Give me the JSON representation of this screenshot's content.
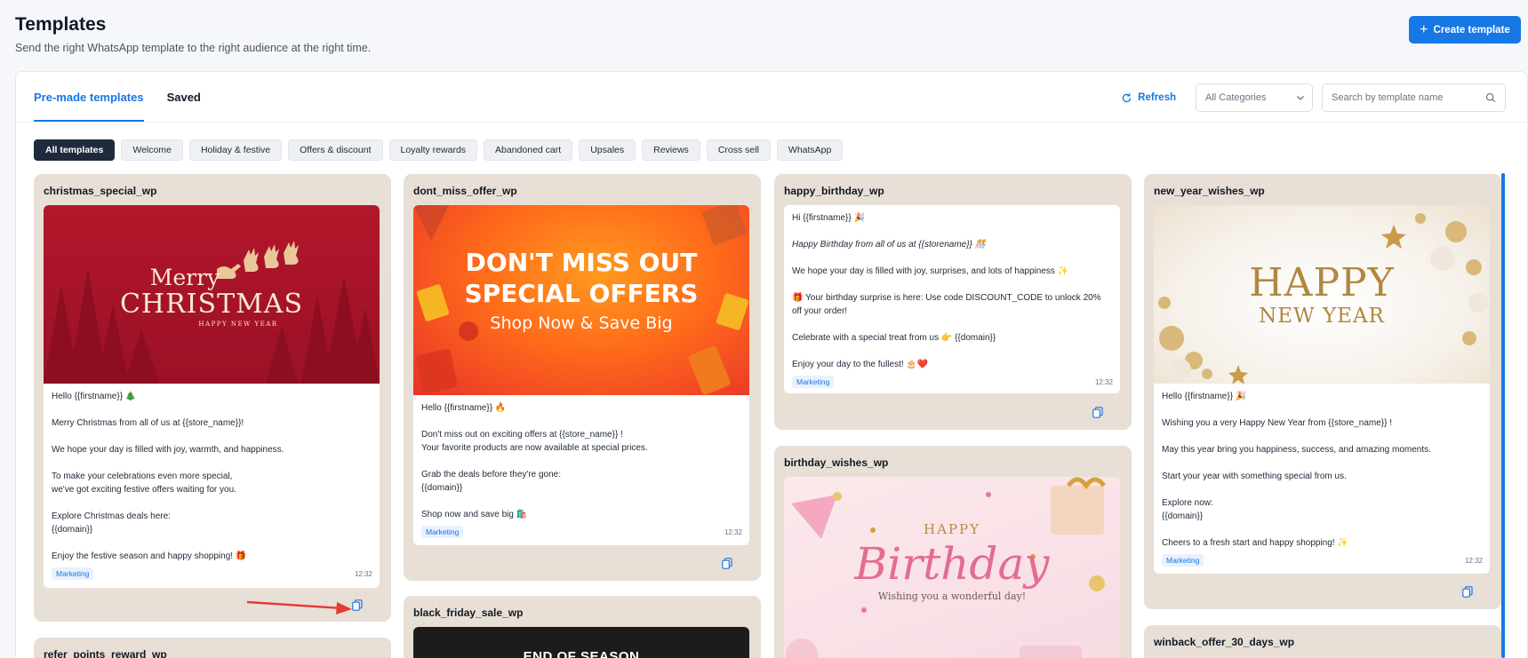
{
  "header": {
    "title": "Templates",
    "subtitle": "Send the right WhatsApp template to the right audience at the right time.",
    "create_label": "Create template"
  },
  "tabs": [
    {
      "label": "Pre-made templates",
      "active": true
    },
    {
      "label": "Saved",
      "active": false
    }
  ],
  "toolbar": {
    "refresh_label": "Refresh",
    "category_value": "All Categories",
    "search_placeholder": "Search by template name"
  },
  "chips": [
    "All templates",
    "Welcome",
    "Holiday & festive",
    "Offers & discount",
    "Loyalty rewards",
    "Abandoned cart",
    "Upsales",
    "Reviews",
    "Cross sell",
    "WhatsApp"
  ],
  "cards": {
    "christmas": {
      "title": "christmas_special_wp",
      "media": {
        "line1": "Merry",
        "line2": "CHRISTMAS",
        "line3": "HAPPY NEW YEAR"
      },
      "lines": [
        "Hello {{firstname}} 🎄",
        "",
        "Merry Christmas from all of us at {{store_name}}!",
        "",
        "We hope your day is filled with joy, warmth, and happiness.",
        "",
        "To make your celebrations even more special,",
        "we've got exciting festive offers waiting for you.",
        "",
        "Explore Christmas deals here:",
        "{{domain}}",
        "",
        "Enjoy the festive season and happy shopping! 🎁"
      ],
      "badge": "Marketing",
      "time": "12:32"
    },
    "dont_miss": {
      "title": "dont_miss_offer_wp",
      "media": {
        "line1": "DON'T MISS OUT",
        "line2": "SPECIAL OFFERS",
        "line3": "Shop Now & Save Big"
      },
      "lines": [
        "Hello {{firstname}} 🔥",
        "",
        "Don't miss out on exciting offers at {{store_name}} !",
        "Your favorite products are now available at special prices.",
        "",
        "Grab the deals before they're gone:",
        "{{domain}}",
        "",
        "Shop now and save big 🛍️"
      ],
      "badge": "Marketing",
      "time": "12:32"
    },
    "black_friday": {
      "title": "black_friday_sale_wp",
      "media": {
        "line1": "END OF SEASON"
      }
    },
    "happy_birthday": {
      "title": "happy_birthday_wp",
      "lines": [
        "Hi {{firstname}} 🎉",
        "",
        "Happy Birthday from all of us at {{storename}} 🎊",
        "",
        "We hope your day is filled with joy, surprises, and lots of happiness ✨",
        "",
        "🎁 Your birthday surprise is here: Use code DISCOUNT_CODE to unlock 20%",
        "off your order!",
        "",
        "Celebrate with a special treat from us 👉 {{domain}}",
        "",
        "Enjoy your day to the fullest! 🎂❤️"
      ],
      "badge": "Marketing",
      "time": "12:32"
    },
    "birthday_wishes": {
      "title": "birthday_wishes_wp",
      "media": {
        "line1": "HAPPY",
        "line2": "Birthday",
        "line3": "Wishing you a wonderful day!"
      }
    },
    "new_year": {
      "title": "new_year_wishes_wp",
      "media": {
        "line1": "HAPPY",
        "line2": "NEW YEAR"
      },
      "lines": [
        "Hello {{firstname}} 🎉",
        "",
        "Wishing you a very Happy New Year from {{store_name}} !",
        "",
        "May this year bring you happiness, success, and amazing moments.",
        "",
        "Start your year with something special from us.",
        "",
        "Explore now:",
        "{{domain}}",
        "",
        "Cheers to a fresh start and happy shopping! ✨"
      ],
      "badge": "Marketing",
      "time": "12:32"
    },
    "refer_points": {
      "title": "refer_points_reward_wp"
    },
    "winback": {
      "title": "winback_offer_30_days_wp"
    }
  },
  "colors": {
    "accent": "#1677e5",
    "chip_active": "#1f2a3d",
    "card_bg": "#e8e0d6",
    "annotation_arrow": "#e53935"
  }
}
